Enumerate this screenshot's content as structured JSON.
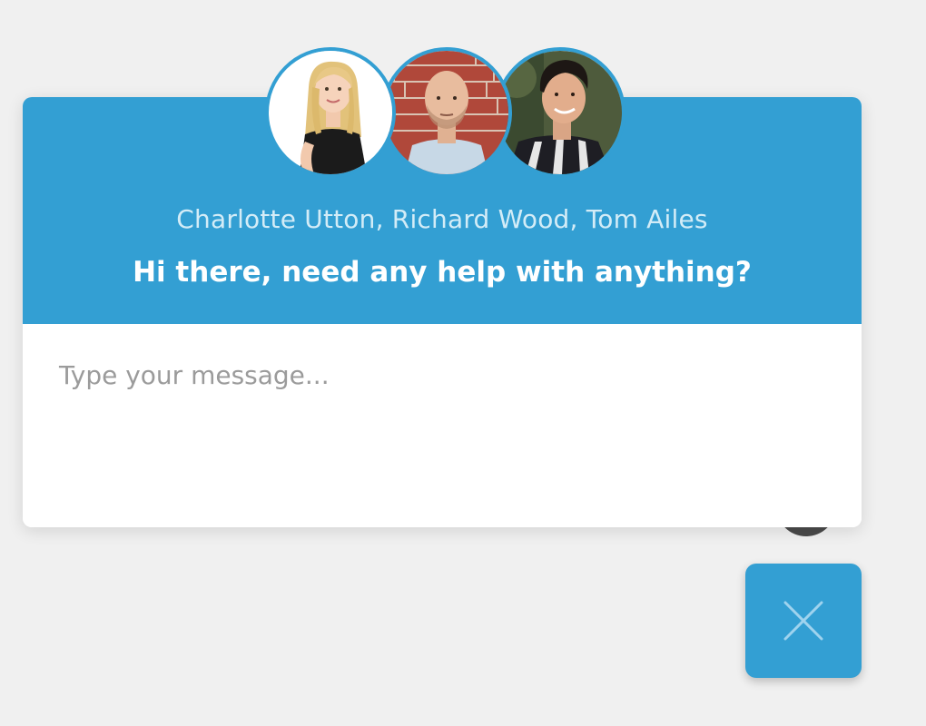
{
  "chat": {
    "agents_line": "Charlotte Utton, Richard Wood, Tom Ailes",
    "greeting": "Hi there, need any help with anything?",
    "input_placeholder": "Type your message...",
    "input_value": ""
  },
  "agents": [
    {
      "name": "Charlotte Utton",
      "icon": "avatar-photo"
    },
    {
      "name": "Richard Wood",
      "icon": "avatar-photo"
    },
    {
      "name": "Tom Ailes",
      "icon": "avatar-photo"
    }
  ],
  "close_button": {
    "icon": "close-icon"
  },
  "colors": {
    "accent": "#339fd3",
    "background": "#f0f0f0",
    "names_text": "#d3ecf7",
    "greeting_text": "#ffffff",
    "placeholder_text": "#9b9b9b"
  }
}
